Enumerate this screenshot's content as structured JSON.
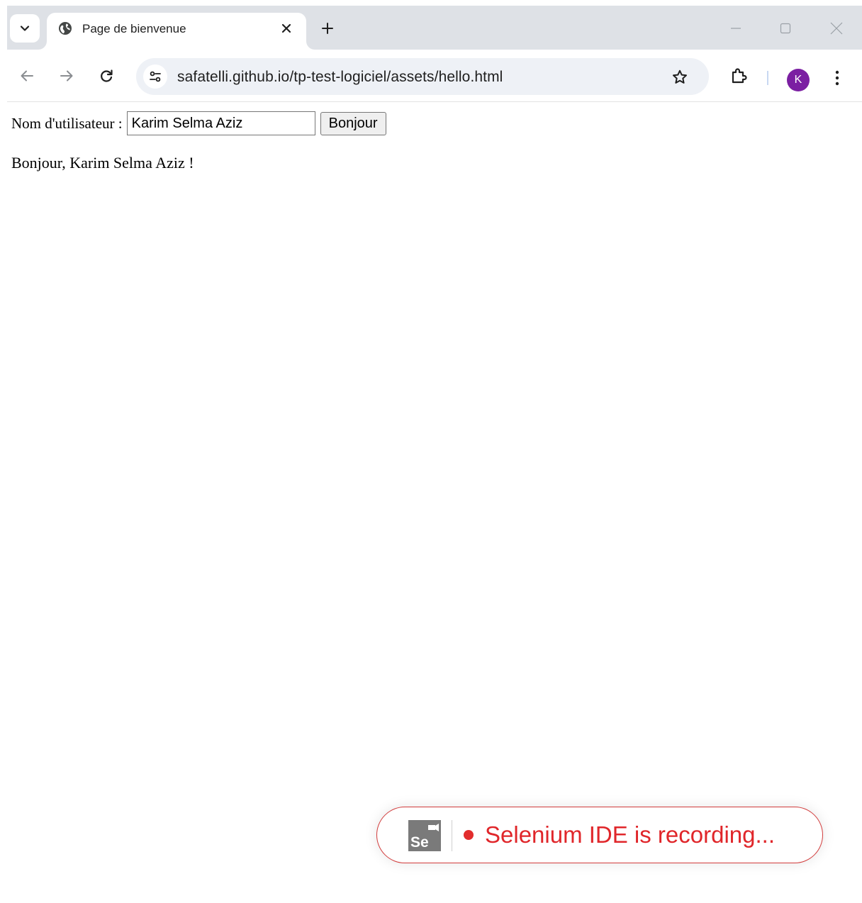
{
  "tab": {
    "title": "Page de bienvenue"
  },
  "address_bar": {
    "url": "safatelli.github.io/tp-test-logiciel/assets/hello.html"
  },
  "profile": {
    "initial": "K",
    "color": "#7b1fa2"
  },
  "page": {
    "label": "Nom d'utilisateur :",
    "input_value": "Karim Selma Aziz",
    "button_label": "Bonjour",
    "greeting": "Bonjour, Karim Selma Aziz !"
  },
  "selenium": {
    "logo_text": "Se",
    "status_text": "Selenium IDE is recording...",
    "accent_color": "#e0262a"
  },
  "icons": {
    "tab_search": "chevron-down-icon",
    "favicon": "globe-icon",
    "tab_close": "close-icon",
    "new_tab": "plus-icon",
    "back": "arrow-left-icon",
    "forward": "arrow-right-icon",
    "reload": "reload-icon",
    "site_info": "tune-icon",
    "bookmark": "star-icon",
    "extensions": "puzzle-icon",
    "menu": "kebab-menu-icon"
  }
}
